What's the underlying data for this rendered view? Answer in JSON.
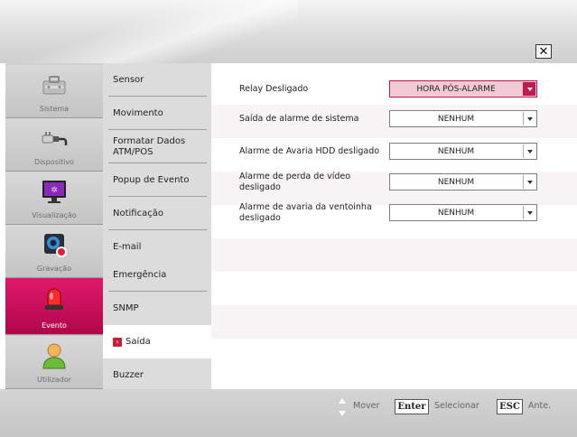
{
  "window": {
    "close_label": "✕"
  },
  "categories": [
    {
      "label": "Sistema",
      "icon": "toolbox-icon",
      "active": false
    },
    {
      "label": "Dispositivo",
      "icon": "device-plug-icon",
      "active": false
    },
    {
      "label": "Visualização",
      "icon": "monitor-icon",
      "active": false
    },
    {
      "label": "Gravação",
      "icon": "camera-record-icon",
      "active": false
    },
    {
      "label": "Evento",
      "icon": "siren-icon",
      "active": true
    },
    {
      "label": "Utilizador",
      "icon": "user-icon",
      "active": false
    }
  ],
  "submenu": [
    {
      "label": "Sensor"
    },
    {
      "label": "Movimento"
    },
    {
      "label": "Formatar Dados ATM/POS"
    },
    {
      "label": "Popup de Evento"
    },
    {
      "label": "Notificação"
    },
    {
      "label": "E-mail"
    },
    {
      "label": "Emergência"
    },
    {
      "label": "SNMP"
    },
    {
      "label": "Saída",
      "active": true
    },
    {
      "label": "Buzzer"
    }
  ],
  "settings": [
    {
      "label": "Relay Desligado",
      "value": "HORA PÓS-ALARME",
      "highlighted": true
    },
    {
      "label": "Saída de alarme de sistema",
      "value": "NENHUM",
      "highlighted": false
    },
    {
      "label": "Alarme de Avaria HDD desligado",
      "value": "NENHUM",
      "highlighted": false
    },
    {
      "label": "Alarme de perda de vídeo desligado",
      "value": "NENHUM",
      "highlighted": false
    },
    {
      "label": "Alarme de avaria da ventoinha desligado",
      "value": "NENHUM",
      "highlighted": false
    }
  ],
  "footer": {
    "move_label": "Mover",
    "enter_key": "Enter",
    "select_label": "Selecionar",
    "esc_key": "ESC",
    "back_label": "Ante."
  },
  "colors": {
    "accent": "#c01a50",
    "active_category": "#d0105e",
    "stripe": "#f7f3f4"
  }
}
